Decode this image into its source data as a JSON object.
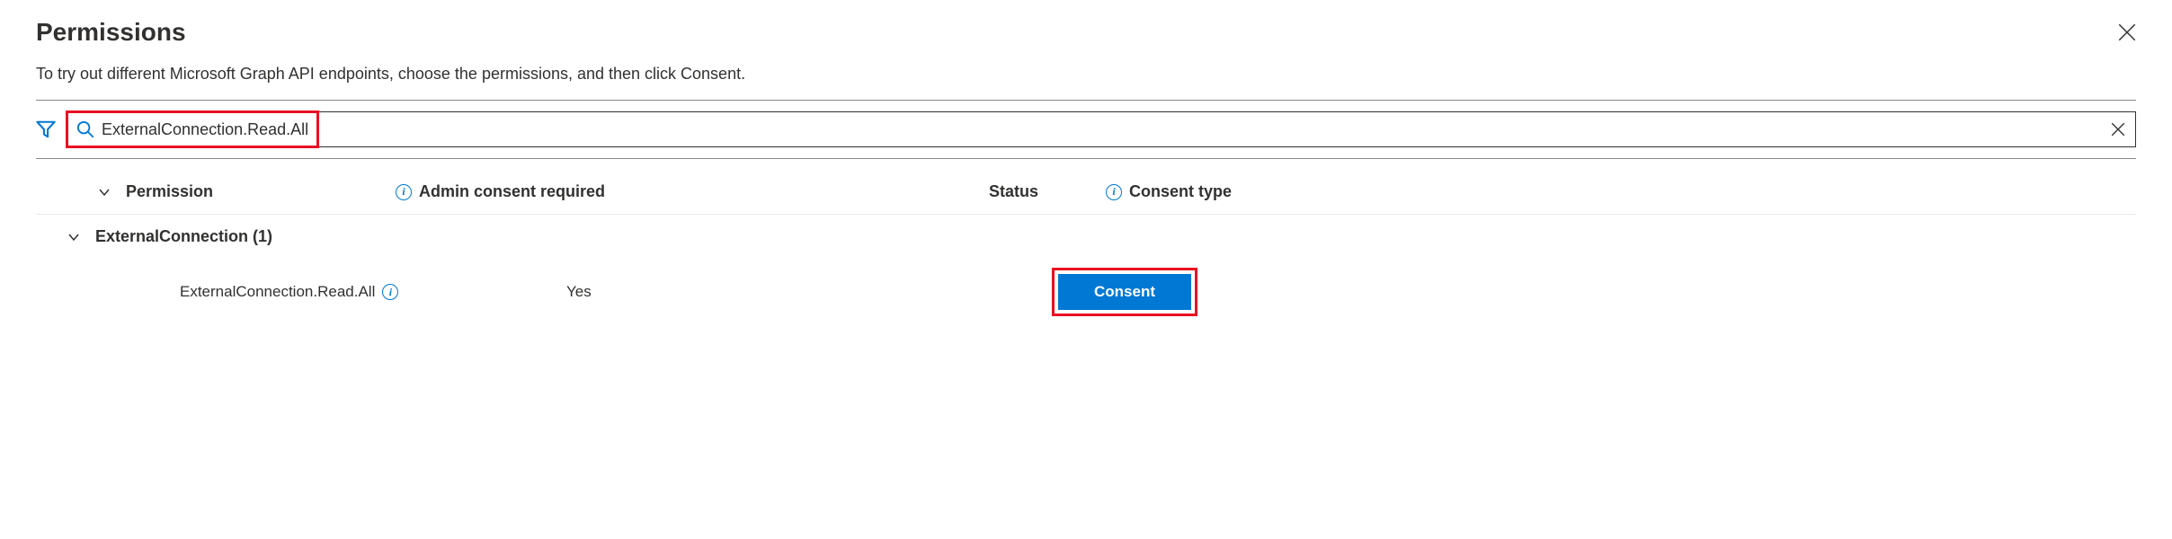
{
  "header": {
    "title": "Permissions",
    "description": "To try out different Microsoft Graph API endpoints, choose the permissions, and then click Consent."
  },
  "search": {
    "value": "ExternalConnection.Read.All"
  },
  "columns": {
    "permission": "Permission",
    "admin_consent": "Admin consent required",
    "status": "Status",
    "consent_type": "Consent type"
  },
  "group": {
    "name": "ExternalConnection (1)"
  },
  "row": {
    "permission_name": "ExternalConnection.Read.All",
    "admin_required": "Yes",
    "consent_button": "Consent"
  }
}
